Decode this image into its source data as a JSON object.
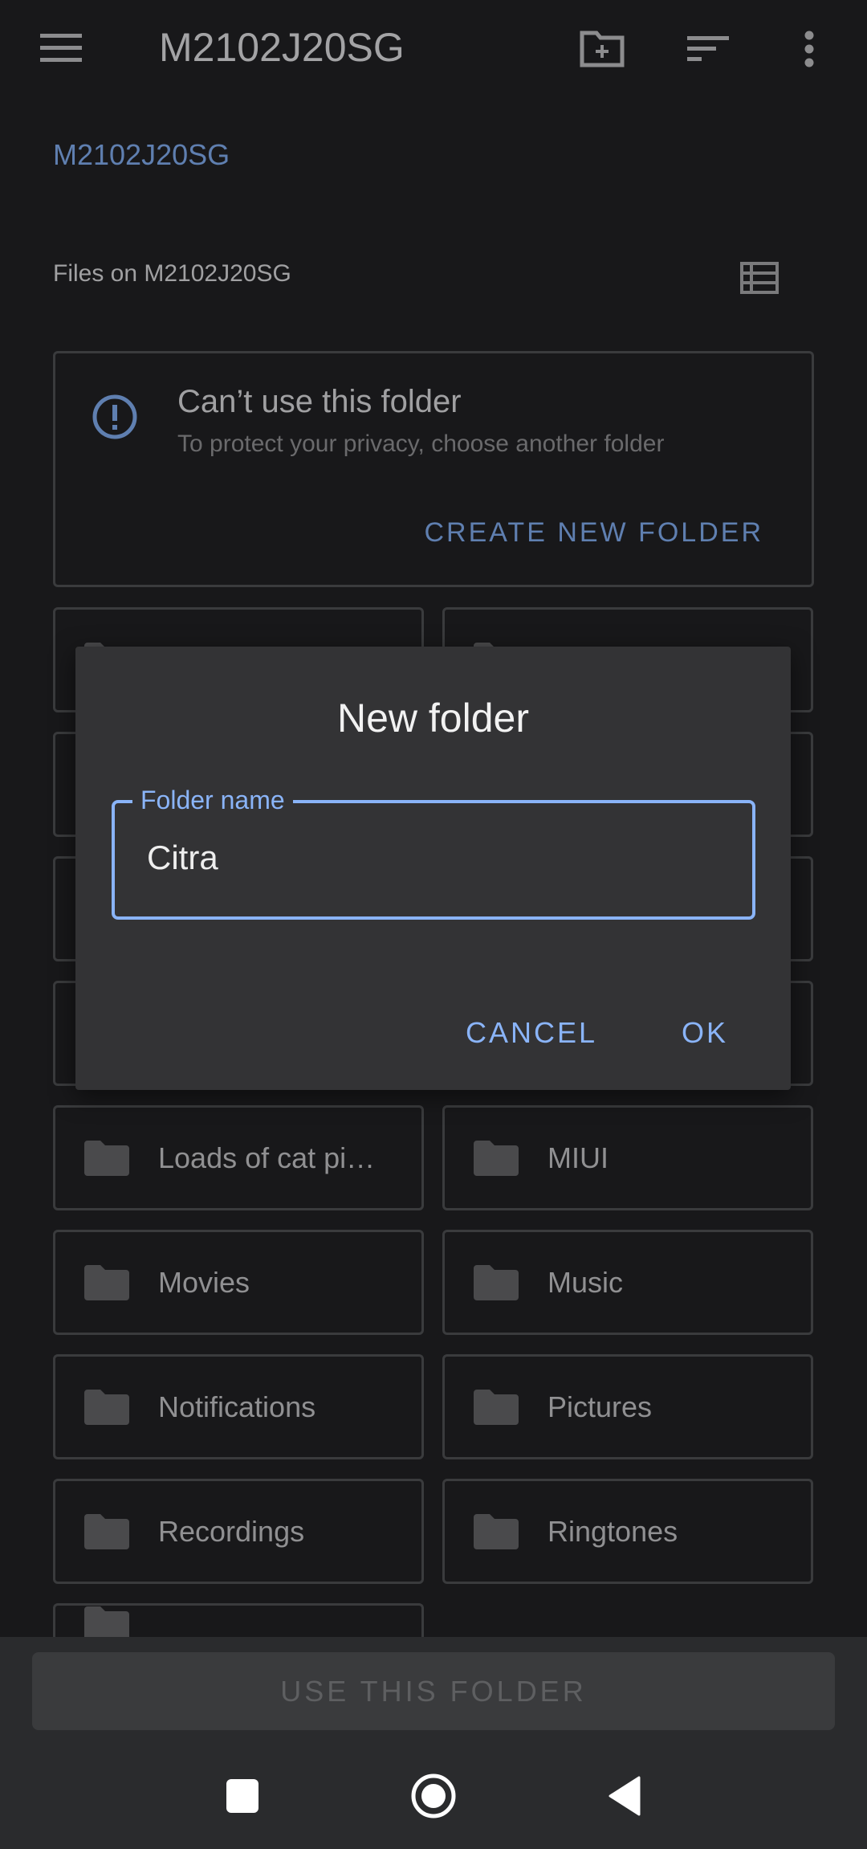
{
  "topbar": {
    "title": "M2102J20SG",
    "icons": [
      "menu-icon",
      "new-folder-icon",
      "sort-icon",
      "more-vert-icon"
    ]
  },
  "breadcrumb": "M2102J20SG",
  "files_label": "Files on M2102J20SG",
  "warning": {
    "title": "Can’t use this folder",
    "subtitle": "To protect your privacy, choose another folder",
    "action": "CREATE NEW FOLDER"
  },
  "folders": [
    "",
    "",
    "",
    "",
    "",
    "",
    "",
    "",
    "Loads of cat pi…",
    "MIUI",
    "Movies",
    "Music",
    "Notifications",
    "Pictures",
    "Recordings",
    "Ringtones",
    ""
  ],
  "dialog": {
    "title": "New folder",
    "field_label": "Folder name",
    "field_value": "Citra",
    "cancel": "CANCEL",
    "ok": "OK"
  },
  "use_button": "USE THIS FOLDER",
  "colors": {
    "accent": "#8ab4f8",
    "muted_accent": "#5f7fb0",
    "background": "#18181a",
    "dialog": "#333335"
  }
}
